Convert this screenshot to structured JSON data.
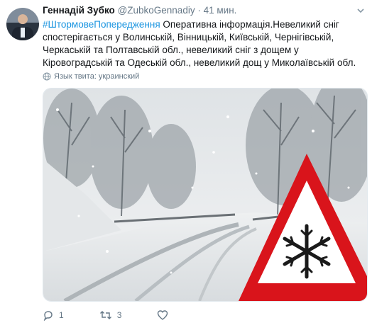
{
  "tweet": {
    "author_name": "Геннадій Зубко",
    "author_handle": "@ZubkoGennadiy",
    "separator": "·",
    "time": "41 мин.",
    "hashtag": "#ШтормовеПопередження",
    "body": " Оперативна інформація.Невеликий сніг спостерігається у Волинській, Вінницькій, Київській, Чернігівській, Черкаській та Полтавській обл., невеликий сніг з дощем у Кіровоградській та Одеській обл., невеликий дощ у Миколаївській обл.",
    "language_label": "Язык твита: украинский"
  },
  "actions": {
    "reply_count": "1",
    "retweet_count": "3",
    "like_count": ""
  },
  "colors": {
    "link": "#1b95e0",
    "secondary_text": "#657786",
    "warning_red": "#d9141b"
  },
  "icons": [
    "chevron-down-icon",
    "globe-icon",
    "reply-icon",
    "retweet-icon",
    "like-icon",
    "snowflake-icon"
  ]
}
